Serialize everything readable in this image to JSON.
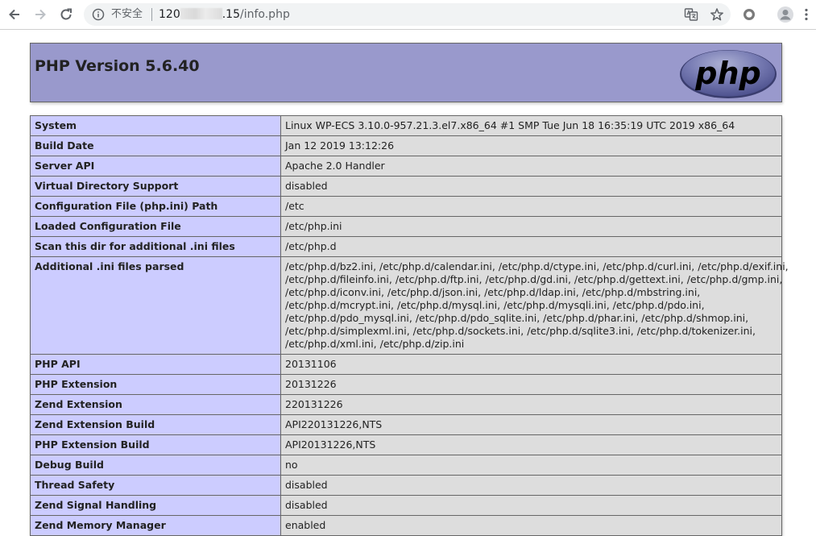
{
  "browser": {
    "security_label": "不安全",
    "url_host_prefix": "120",
    "url_host_suffix": ".15",
    "url_path": "/info.php",
    "icons": [
      "back-icon",
      "forward-icon",
      "reload-icon",
      "info-icon",
      "translate-icon",
      "star-icon",
      "extension-icon",
      "profile-icon",
      "menu-icon"
    ]
  },
  "header": {
    "title": "PHP Version 5.6.40",
    "logo_text": "php",
    "bg_color": "#9999cc"
  },
  "table": {
    "label_bg": "#ccccff",
    "value_bg": "#dddddd",
    "rows": [
      {
        "label": "System",
        "value": "Linux WP-ECS 3.10.0-957.21.3.el7.x86_64 #1 SMP Tue Jun 18 16:35:19 UTC 2019 x86_64"
      },
      {
        "label": "Build Date",
        "value": "Jan 12 2019 13:12:26"
      },
      {
        "label": "Server API",
        "value": "Apache 2.0 Handler"
      },
      {
        "label": "Virtual Directory Support",
        "value": "disabled"
      },
      {
        "label": "Configuration File (php.ini) Path",
        "value": "/etc"
      },
      {
        "label": "Loaded Configuration File",
        "value": "/etc/php.ini"
      },
      {
        "label": "Scan this dir for additional .ini files",
        "value": "/etc/php.d"
      },
      {
        "label": "Additional .ini files parsed",
        "value_lines": [
          "/etc/php.d/bz2.ini, /etc/php.d/calendar.ini, /etc/php.d/ctype.ini, /etc/php.d/curl.ini, /etc/php.d/exif.ini,",
          "/etc/php.d/fileinfo.ini, /etc/php.d/ftp.ini, /etc/php.d/gd.ini, /etc/php.d/gettext.ini, /etc/php.d/gmp.ini,",
          "/etc/php.d/iconv.ini, /etc/php.d/json.ini, /etc/php.d/ldap.ini, /etc/php.d/mbstring.ini,",
          "/etc/php.d/mcrypt.ini, /etc/php.d/mysql.ini, /etc/php.d/mysqli.ini, /etc/php.d/pdo.ini,",
          "/etc/php.d/pdo_mysql.ini, /etc/php.d/pdo_sqlite.ini, /etc/php.d/phar.ini, /etc/php.d/shmop.ini,",
          "/etc/php.d/simplexml.ini, /etc/php.d/sockets.ini, /etc/php.d/sqlite3.ini, /etc/php.d/tokenizer.ini,",
          "/etc/php.d/xml.ini, /etc/php.d/zip.ini"
        ]
      },
      {
        "label": "PHP API",
        "value": "20131106"
      },
      {
        "label": "PHP Extension",
        "value": "20131226"
      },
      {
        "label": "Zend Extension",
        "value": "220131226"
      },
      {
        "label": "Zend Extension Build",
        "value": "API220131226,NTS"
      },
      {
        "label": "PHP Extension Build",
        "value": "API20131226,NTS"
      },
      {
        "label": "Debug Build",
        "value": "no"
      },
      {
        "label": "Thread Safety",
        "value": "disabled"
      },
      {
        "label": "Zend Signal Handling",
        "value": "disabled"
      },
      {
        "label": "Zend Memory Manager",
        "value": "enabled"
      }
    ]
  }
}
